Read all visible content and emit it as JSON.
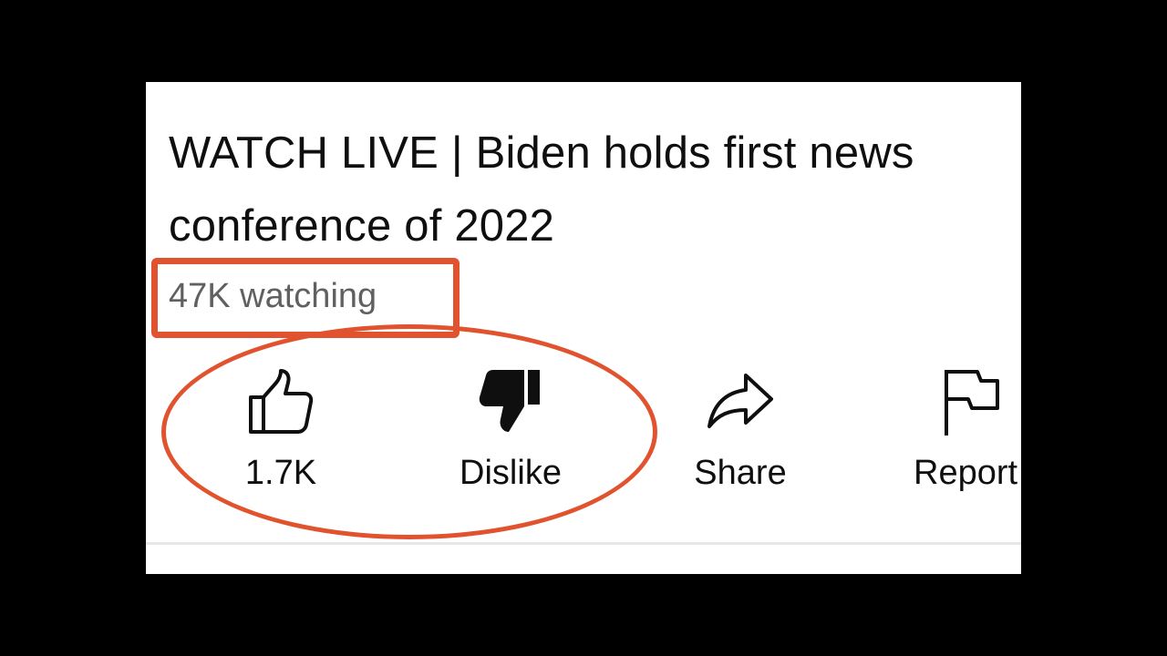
{
  "video": {
    "title": "WATCH LIVE | Biden holds first news conference of 2022",
    "viewers": "47K watching"
  },
  "actions": {
    "like": {
      "label": "1.7K",
      "icon": "thumbs-up-outline-icon"
    },
    "dislike": {
      "label": "Dislike",
      "icon": "thumbs-down-filled-icon"
    },
    "share": {
      "label": "Share",
      "icon": "share-arrow-icon"
    },
    "report": {
      "label": "Report",
      "icon": "flag-icon"
    }
  },
  "colors": {
    "background_frame": "#000000",
    "panel": "#ffffff",
    "text_primary": "#0f0f0f",
    "text_secondary": "#606060",
    "annotation": "#e1532e",
    "divider": "#e8e8e8"
  }
}
